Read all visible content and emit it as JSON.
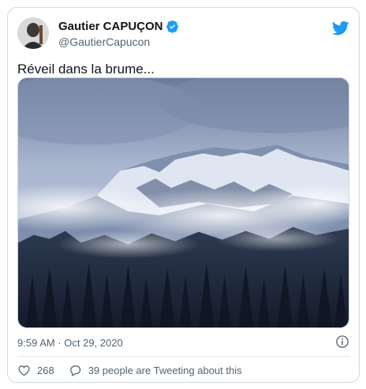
{
  "tweet": {
    "author": {
      "name": "Gautier CAPUÇON",
      "handle": "@GautierCapucon",
      "verified": true
    },
    "text": "Réveil dans la brume...",
    "timestamp": "9:59 AM · Oct 29, 2020",
    "likes": "268",
    "conversation": "39 people are Tweeting about this"
  },
  "icons": {
    "brand": "twitter-bird-icon",
    "verified": "verified-badge-icon",
    "info": "info-icon",
    "like": "heart-icon",
    "reply": "comment-bubble-icon"
  },
  "colors": {
    "brand_blue": "#1d9bf0",
    "text": "#0f1419",
    "secondary": "#536471",
    "border": "#cfd9de"
  }
}
